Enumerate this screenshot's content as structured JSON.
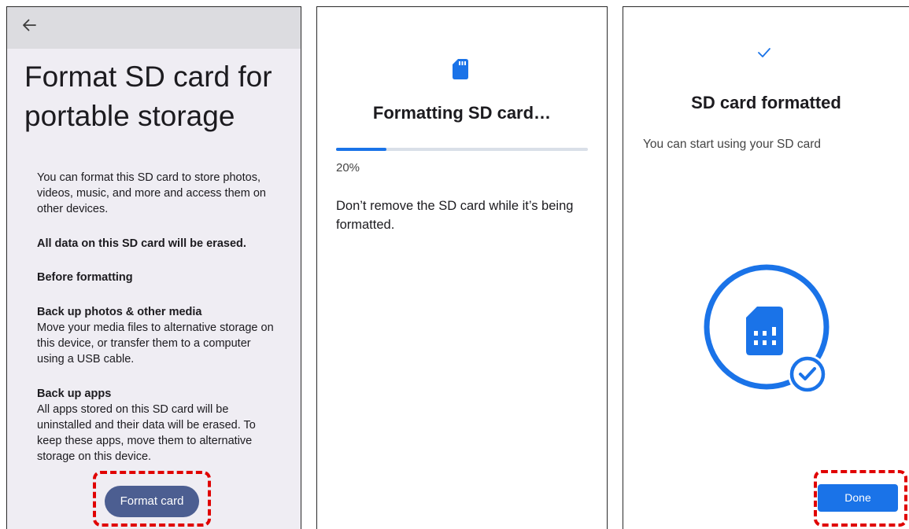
{
  "screen1": {
    "back_icon": "arrow-back-icon",
    "title": "Format SD card for portable storage",
    "intro": "You can format this SD card to store photos, videos, music, and more and access them on other devices.",
    "warning": "All data on this SD card will be erased.",
    "before_heading": "Before formatting",
    "backup_media_heading": "Back up photos & other media",
    "backup_media_text": "Move your media files to alternative storage on this device, or transfer them to a computer using a USB cable.",
    "backup_apps_heading": "Back up apps",
    "backup_apps_text": "All apps stored on this SD card will be uninstalled and their data will be erased. To keep these apps, move them to alternative storage on this device.",
    "format_button": "Format card"
  },
  "screen2": {
    "icon": "sd-card-icon",
    "title": "Formatting SD card…",
    "progress_percent": 20,
    "progress_label": "20%",
    "message": "Don’t remove the SD card while it’s being formatted."
  },
  "screen3": {
    "icon": "check-icon",
    "title": "SD card formatted",
    "subtitle": "You can start using your SD card",
    "illustration": "sd-card-check-illustration",
    "done_button": "Done"
  },
  "colors": {
    "accent_blue": "#1a73e8",
    "format_button": "#4c5e91",
    "highlight_red": "#e00000",
    "screen1_background": "#efedf3"
  }
}
